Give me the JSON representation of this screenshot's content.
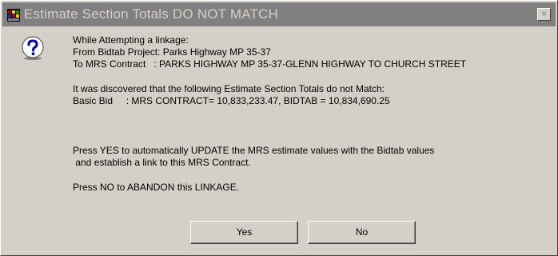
{
  "dialog": {
    "title": "Estimate Section Totals DO NOT MATCH",
    "close_label": "×",
    "icon": "question-icon",
    "lines": {
      "l1": "While Attempting a linkage:",
      "l2": "From Bidtab Project: Parks Highway MP 35-37",
      "l3": "To MRS Contract   : PARKS HIGHWAY MP 35-37-GLENN HIGHWAY TO CHURCH STREET",
      "l4": "It was discovered that the following Estimate Section Totals do not Match:",
      "l5": "Basic Bid     : MRS CONTRACT= 10,833,233.47, BIDTAB = 10,834,690.25",
      "l6": "Press YES to automatically UPDATE the MRS estimate values with the Bidtab values",
      "l7": " and establish a link to this MRS Contract.",
      "l8": "Press NO to ABANDON this LINKAGE."
    },
    "yes_label": "Yes",
    "no_label": "No"
  },
  "colors": {
    "face": "#d4d0c8",
    "titlebar_inactive": "#808080",
    "title_text": "#d4d0c8"
  }
}
